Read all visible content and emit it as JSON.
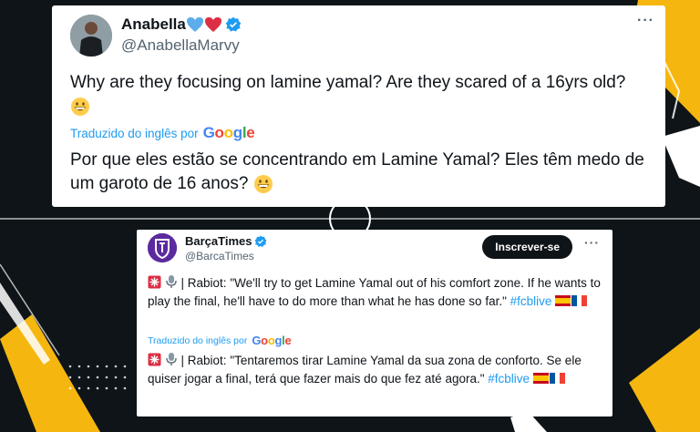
{
  "colors": {
    "background": "#0e1418",
    "accent_yellow": "#f5b60f",
    "link_blue": "#1d9bf0",
    "verified_blue": "#1d9bf0",
    "text": "#0f1419",
    "secondary_text": "#536471"
  },
  "tweet1": {
    "display_name": "Anabella",
    "name_emojis": [
      "blue-heart-icon",
      "red-heart-icon"
    ],
    "handle": "@AnabellaMarvy",
    "more_label": "···",
    "text": "Why are they focusing on lamine yamal? Are they scared of a 16yrs old?",
    "text_emoji": "grinning-face-icon",
    "translated_label": "Traduzido do inglês por",
    "translated_text": "Por que eles estão se concentrando em Lamine Yamal? Eles têm medo de um garoto de 16 anos?",
    "translated_emoji": "grinning-face-icon"
  },
  "tweet2": {
    "display_name": "BarçaTimes",
    "handle": "@BarcaTimes",
    "subscribe_label": "Inscrever-se",
    "more_label": "···",
    "text_prefix": "| Rabiot: \"We'll try to get Lamine Yamal out of his comfort zone. If he wants to play the final, he'll have to do more than what he has done so far.\"",
    "hashtag": "#fcblive",
    "translated_label": "Traduzido do inglês por",
    "translated_prefix": "| Rabiot: \"Tentaremos tirar Lamine Yamal da sua zona de conforto. Se ele quiser jogar a final, terá que fazer mais do que fez até agora.\"",
    "translated_hashtag": "#fcblive",
    "icons": [
      "siren-icon",
      "microphone-icon",
      "flag-spain-icon",
      "flag-france-icon"
    ]
  },
  "google": {
    "G": "G",
    "o1": "o",
    "o2": "o",
    "g": "g",
    "l": "l",
    "e": "e"
  }
}
